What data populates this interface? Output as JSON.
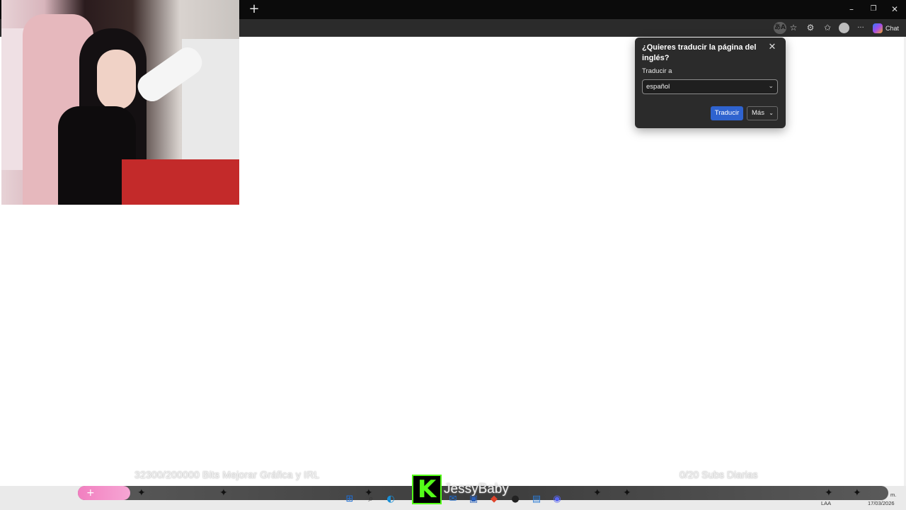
{
  "browser": {
    "new_tab_glyph": "+",
    "window_controls": [
      "–",
      "❐",
      "✕"
    ],
    "toolbar_icons": [
      "translate-icon",
      "favorite-star-icon",
      "extensions-icon",
      "favorites-icon",
      "profile-icon",
      "more-icon"
    ],
    "translate_icon_glyph": "あA",
    "more_glyph": "···",
    "chat_label": "Chat"
  },
  "translate_popup": {
    "title": "¿Quieres traducir la página del inglés?",
    "close_glyph": "✕",
    "target_label": "Traducir a",
    "selected_language": "español",
    "chevron_glyph": "⌄",
    "translate_button": "Traducir",
    "more_button": "Más"
  },
  "stream_overlay": {
    "goal_left": "32300/200000 Bits Mejorar Gráfica y IRL",
    "goal_right": "0/20 Subs Diarias",
    "channel_name": "JessyBaby",
    "platform_logo_letter": "K",
    "pill_glyph": "+"
  },
  "taskbar": {
    "tray_text_1": "m.",
    "tray_lang": "LAA",
    "tray_date": "17/03/2026",
    "apps": [
      "windows-start-icon",
      "search-icon",
      "edge-icon",
      "outlook-icon",
      "store-icon",
      "brave-icon",
      "obs-icon",
      "notepad-icon",
      "discord-icon"
    ]
  },
  "colors": {
    "popup_bg": "#2b2b2b",
    "accent_blue": "#2f63cf",
    "kick_green": "#53fc18",
    "tab_bar": "#0b0b0b"
  }
}
